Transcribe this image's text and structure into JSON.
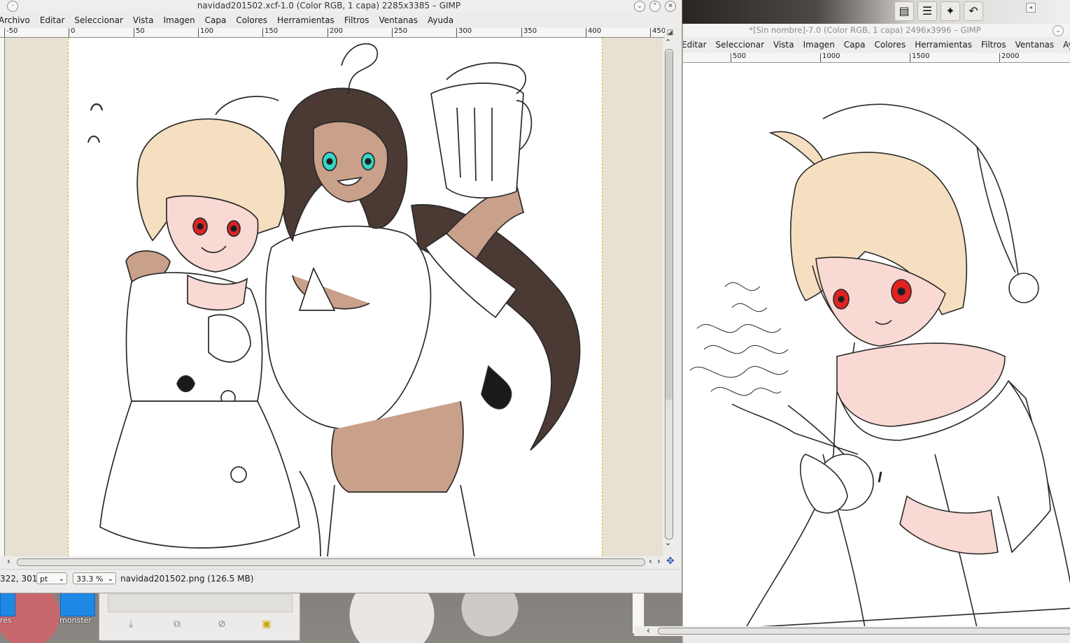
{
  "window_main": {
    "title": "navidad201502.xcf-1.0 (Color RGB, 1 capa) 2285x3385 – GIMP",
    "menu": [
      "Archivo",
      "Editar",
      "Seleccionar",
      "Vista",
      "Imagen",
      "Capa",
      "Colores",
      "Herramientas",
      "Filtros",
      "Ventanas",
      "Ayuda"
    ],
    "ruler_ticks": [
      "-50",
      "0",
      "50",
      "100",
      "150",
      "200",
      "250",
      "300",
      "350",
      "400",
      "450"
    ],
    "status": {
      "coords": "322, 301",
      "unit": "pt",
      "zoom": "33.3 %",
      "info": "navidad201502.png (126.5 MB)"
    }
  },
  "window_second": {
    "title": "*[Sin nombre]-7.0 (Color RGB, 1 capa) 2496x3996 – GIMP",
    "menu": [
      "Editar",
      "Seleccionar",
      "Vista",
      "Imagen",
      "Capa",
      "Colores",
      "Herramientas",
      "Filtros",
      "Ventanas",
      "Ayuda"
    ],
    "ruler_ticks": [
      "500",
      "1000",
      "1500",
      "2000"
    ]
  },
  "desktop": {
    "icon_labels": [
      "res",
      "monster"
    ]
  },
  "colors": {
    "window_bg": "#edeceb",
    "canvas_padding": "#e7e1d4",
    "skin_light": "#f9d9d3",
    "hair_blonde": "#f5dfc0",
    "hair_dark": "#4b3934",
    "skin_dark": "#c9a089",
    "eyes_red": "#e22222",
    "eyes_teal": "#35d7c8"
  }
}
